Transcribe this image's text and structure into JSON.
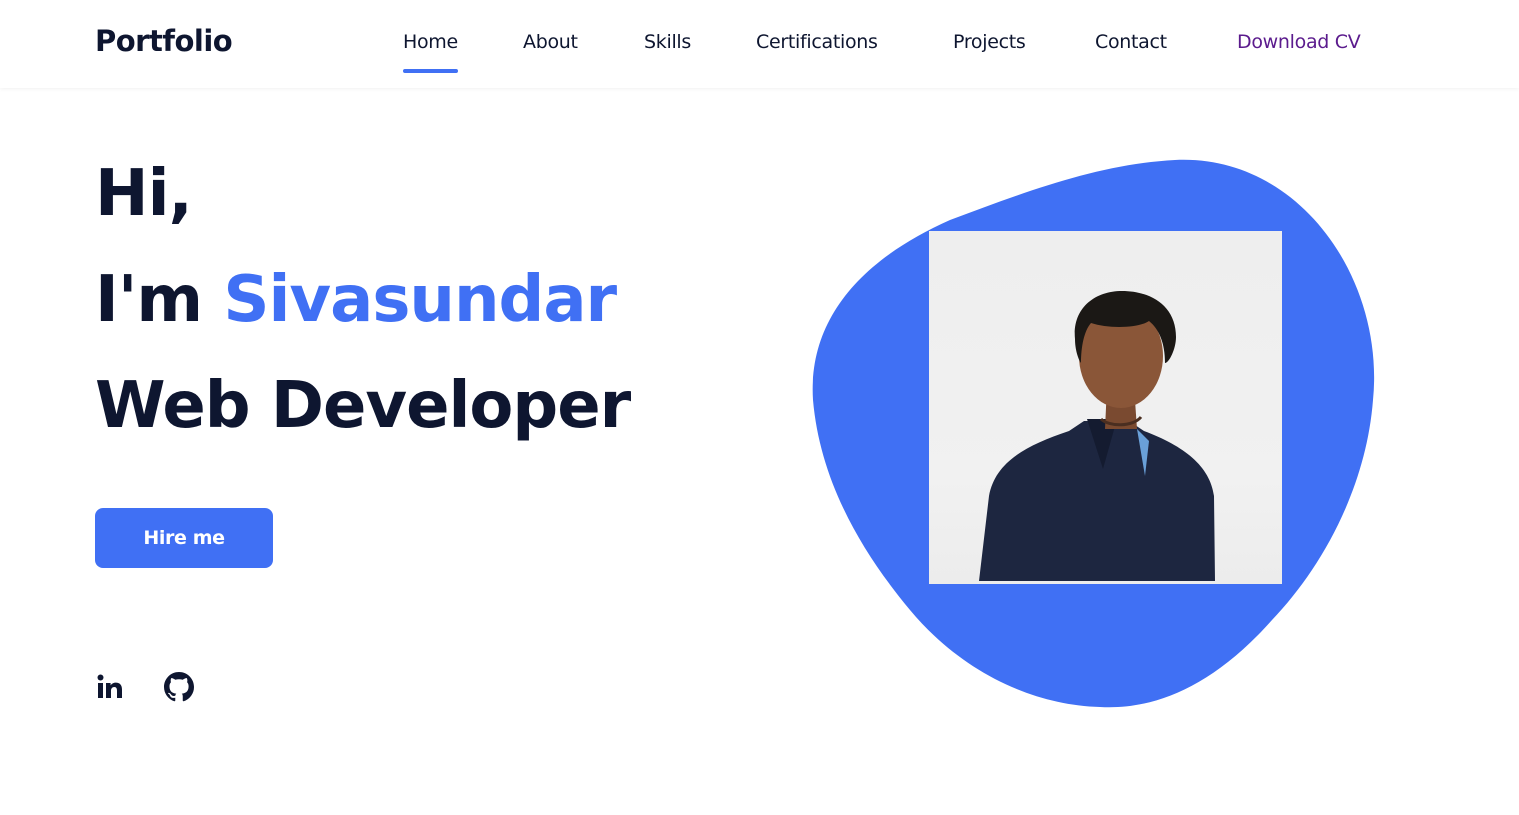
{
  "header": {
    "logo": "Portfolio",
    "nav": [
      {
        "label": "Home",
        "active": true
      },
      {
        "label": "About"
      },
      {
        "label": "Skills"
      },
      {
        "label": "Certifications"
      },
      {
        "label": "Projects"
      },
      {
        "label": "Contact"
      },
      {
        "label": "Download CV"
      }
    ]
  },
  "hero": {
    "greeting": "Hi,",
    "intro_prefix": "I'm",
    "name": "Sivasundar",
    "role": "Web Developer",
    "cta_label": "Hire me"
  },
  "social": [
    {
      "icon": "linkedin-icon"
    },
    {
      "icon": "github-icon"
    }
  ],
  "colors": {
    "accent": "#4070f4",
    "text": "#0e1630",
    "download_link": "#5b1b8d",
    "background": "#ffffff"
  }
}
